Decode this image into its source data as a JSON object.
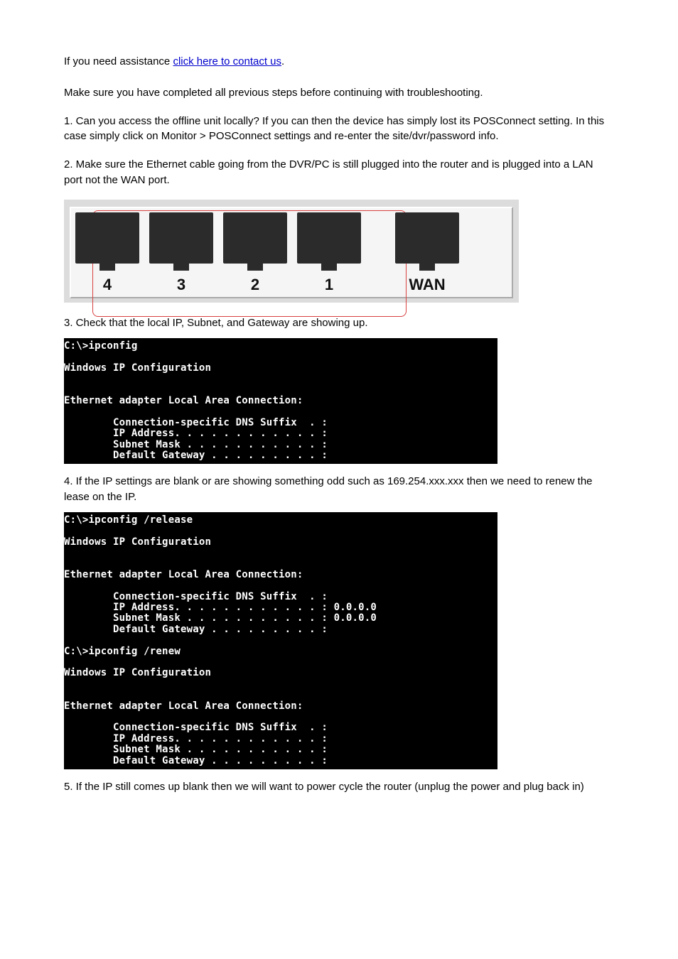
{
  "intro": {
    "contact_prefix": "If you need assistance ",
    "contact_link_text": "click here to contact us",
    "contact_suffix": "."
  },
  "header": {
    "text": "Make sure you have completed all previous steps before continuing with troubleshooting."
  },
  "step1": {
    "text": "1. Can you access the offline unit locally? If you can then the device has simply lost its POSConnect setting.  In this case simply click on Monitor > POSConnect settings and re-enter the site/dvr/password info."
  },
  "step2": {
    "text": "2. Make sure the Ethernet cable going from the DVR/PC is still plugged into the router and is plugged into a LAN port not the WAN port."
  },
  "router": {
    "lan_labels": [
      "4",
      "3",
      "2",
      "1"
    ],
    "wan_label": "WAN"
  },
  "step3": {
    "text": "3.  Check that the local IP, Subnet, and Gateway are showing up.",
    "cmd": "C:\\>ipconfig\n\nWindows IP Configuration\n\n\nEthernet adapter Local Area Connection:\n\n        Connection-specific DNS Suffix  . :\n        IP Address. . . . . . . . . . . . :\n        Subnet Mask . . . . . . . . . . . :\n        Default Gateway . . . . . . . . . :"
  },
  "step4": {
    "text": "4. If the IP settings are blank or are showing something odd such as 169.254.xxx.xxx then we need to renew the lease on the IP.",
    "cmd": "C:\\>ipconfig /release\n\nWindows IP Configuration\n\n\nEthernet adapter Local Area Connection:\n\n        Connection-specific DNS Suffix  . :\n        IP Address. . . . . . . . . . . . : 0.0.0.0\n        Subnet Mask . . . . . . . . . . . : 0.0.0.0\n        Default Gateway . . . . . . . . . :\n\nC:\\>ipconfig /renew\n\nWindows IP Configuration\n\n\nEthernet adapter Local Area Connection:\n\n        Connection-specific DNS Suffix  . :\n        IP Address. . . . . . . . . . . . :\n        Subnet Mask . . . . . . . . . . . :\n        Default Gateway . . . . . . . . . :"
  },
  "step5": {
    "text": "5. If the IP still comes up blank then we will want to power cycle the router (unplug the power and plug back in)"
  }
}
